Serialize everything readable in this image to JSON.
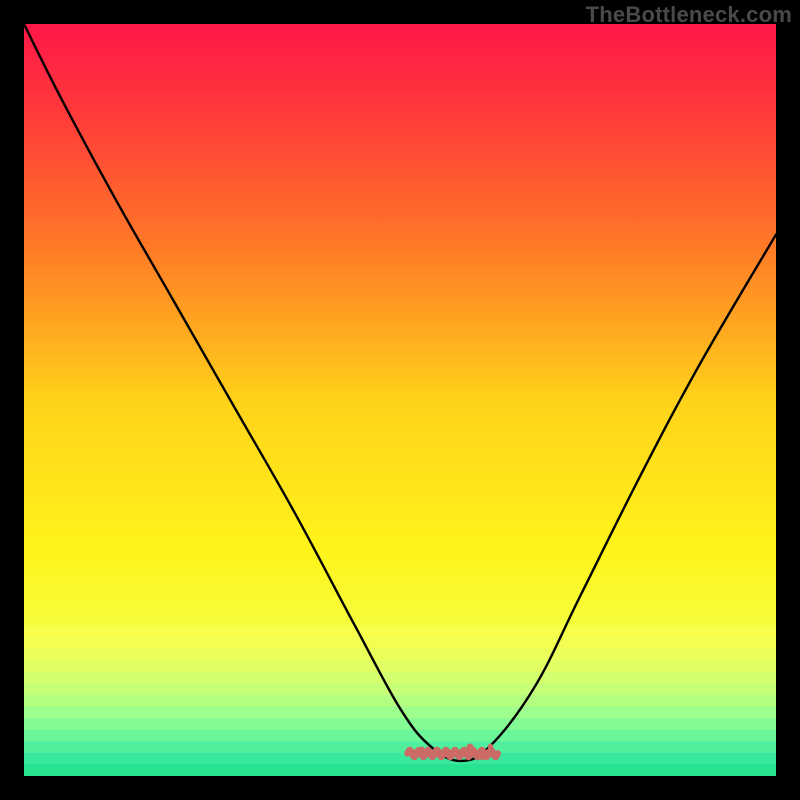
{
  "watermark": "TheBottleneck.com",
  "colors": {
    "background": "#000000",
    "gradient_stops": [
      {
        "offset": 0.0,
        "color": "#ff1748"
      },
      {
        "offset": 0.12,
        "color": "#ff3a3a"
      },
      {
        "offset": 0.3,
        "color": "#ff7b26"
      },
      {
        "offset": 0.5,
        "color": "#ffd21a"
      },
      {
        "offset": 0.7,
        "color": "#fff41a"
      },
      {
        "offset": 0.82,
        "color": "#f4ff44"
      },
      {
        "offset": 0.9,
        "color": "#c6ff5a"
      },
      {
        "offset": 0.955,
        "color": "#72ff88"
      },
      {
        "offset": 1.0,
        "color": "#27e68e"
      }
    ],
    "band_colors": [
      "#f8ff4a",
      "#f2ff52",
      "#ebff5a",
      "#e0ff64",
      "#d4ff6e",
      "#c6ff78",
      "#b4ff82",
      "#9eff8c",
      "#86fb94",
      "#6cf69a",
      "#50ef9e",
      "#38e89c",
      "#27e28e"
    ],
    "curve": "#000000",
    "squiggle": "#cc6b66"
  },
  "chart_data": {
    "type": "line",
    "title": "",
    "xlabel": "",
    "ylabel": "",
    "xlim": [
      0,
      100
    ],
    "ylim": [
      0,
      100
    ],
    "series": [
      {
        "name": "bottleneck-curve",
        "x": [
          0,
          5,
          12,
          20,
          28,
          36,
          44,
          50,
          54,
          58,
          62,
          68,
          74,
          82,
          90,
          100
        ],
        "values": [
          100,
          90,
          77,
          63,
          49,
          35,
          20,
          9,
          4,
          2,
          4,
          12,
          24,
          40,
          55,
          72
        ]
      }
    ],
    "annotations": [
      {
        "name": "optimal-range-squiggle",
        "x_start": 51,
        "x_end": 63,
        "y": 3
      }
    ]
  }
}
